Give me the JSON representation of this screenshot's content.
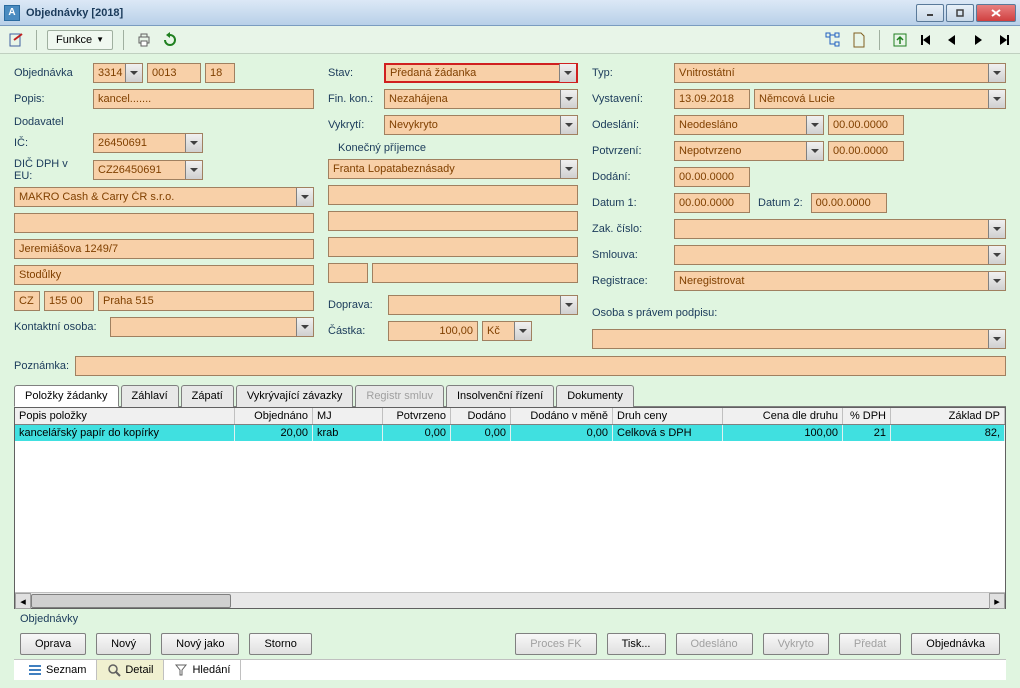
{
  "window": {
    "title": "Objednávky [2018]"
  },
  "toolbar": {
    "funkce": "Funkce"
  },
  "form": {
    "objednavka_lbl": "Objednávka",
    "objednavka_a": "3314",
    "objednavka_b": "0013",
    "objednavka_c": "18",
    "popis_lbl": "Popis:",
    "popis": "kancel.......",
    "dodavatel_hdr": "Dodavatel",
    "ic_lbl": "IČ:",
    "ic": "26450691",
    "dicdph_lbl": "DIČ DPH v EU:",
    "dicdph": "CZ26450691",
    "dodavatel_name": "MAKRO Cash & Carry ČR s.r.o.",
    "dodavatel_2": "",
    "adresa1": "Jeremiášova 1249/7",
    "adresa2": "Stodůlky",
    "zeme": "CZ",
    "psc": "155 00",
    "mesto": "Praha 515",
    "kontakt_lbl": "Kontaktní osoba:",
    "kontakt": "",
    "stav_lbl": "Stav:",
    "stav": "Předaná žádanka",
    "finkon_lbl": "Fin. kon.:",
    "finkon": "Nezahájena",
    "vykryti_lbl": "Vykrytí:",
    "vykryti": "Nevykryto",
    "konecny_hdr": "Konečný příjemce",
    "konecny_name": "Franta Lopatabeznásady",
    "doprava_lbl": "Doprava:",
    "castka_lbl": "Částka:",
    "castka": "100,00",
    "castka_mena": "Kč",
    "typ_lbl": "Typ:",
    "typ": "Vnitrostátní",
    "vystaveni_lbl": "Vystavení:",
    "vystaveni_dat": "13.09.2018",
    "vystaveni_osoba": "Němcová Lucie",
    "odeslani_lbl": "Odeslání:",
    "odeslani": "Neodesláno",
    "odeslani_dat": "00.00.0000",
    "potvrzeni_lbl": "Potvrzení:",
    "potvrzeni": "Nepotvrzeno",
    "potvrzeni_dat": "00.00.0000",
    "dodani_lbl": "Dodání:",
    "dodani_dat": "00.00.0000",
    "datum1_lbl": "Datum 1:",
    "datum1": "00.00.0000",
    "datum2_lbl": "Datum 2:",
    "datum2": "00.00.0000",
    "zakcislo_lbl": "Zak. číslo:",
    "smlouva_lbl": "Smlouva:",
    "registrace_lbl": "Registrace:",
    "registrace": "Neregistrovat",
    "osoba_podpis_lbl": "Osoba s právem podpisu:",
    "poznamka_lbl": "Poznámka:"
  },
  "tabs": {
    "polozky": "Položky žádanky",
    "zahlavi": "Záhlaví",
    "zapati": "Zápatí",
    "vykryvajici": "Vykrývající závazky",
    "registr": "Registr smluv",
    "insolvence": "Insolvenční řízení",
    "dokumenty": "Dokumenty"
  },
  "grid": {
    "headers": {
      "popis": "Popis položky",
      "objednano": "Objednáno",
      "mj": "MJ",
      "potvrzeno": "Potvrzeno",
      "dodano": "Dodáno",
      "dodano_mene": "Dodáno v měně",
      "druh": "Druh ceny",
      "cena": "Cena dle druhu",
      "dph": "% DPH",
      "zaklad": "Základ DP"
    },
    "row": {
      "popis": "kancelářský papír do kopírky",
      "objednano": "20,00",
      "mj": "krab",
      "potvrzeno": "0,00",
      "dodano": "0,00",
      "dodano_mene": "0,00",
      "druh": "Celková s DPH",
      "cena": "100,00",
      "dph": "21",
      "zaklad": "82,"
    }
  },
  "subheader": "Objednávky",
  "buttons": {
    "oprava": "Oprava",
    "novy": "Nový",
    "novy_jako": "Nový jako",
    "storno": "Storno",
    "proces_fk": "Proces FK",
    "tisk": "Tisk...",
    "odeslano": "Odesláno",
    "vykryto": "Vykryto",
    "predat": "Předat",
    "objednavka": "Objednávka"
  },
  "viewtabs": {
    "seznam": "Seznam",
    "detail": "Detail",
    "hledani": "Hledání"
  }
}
